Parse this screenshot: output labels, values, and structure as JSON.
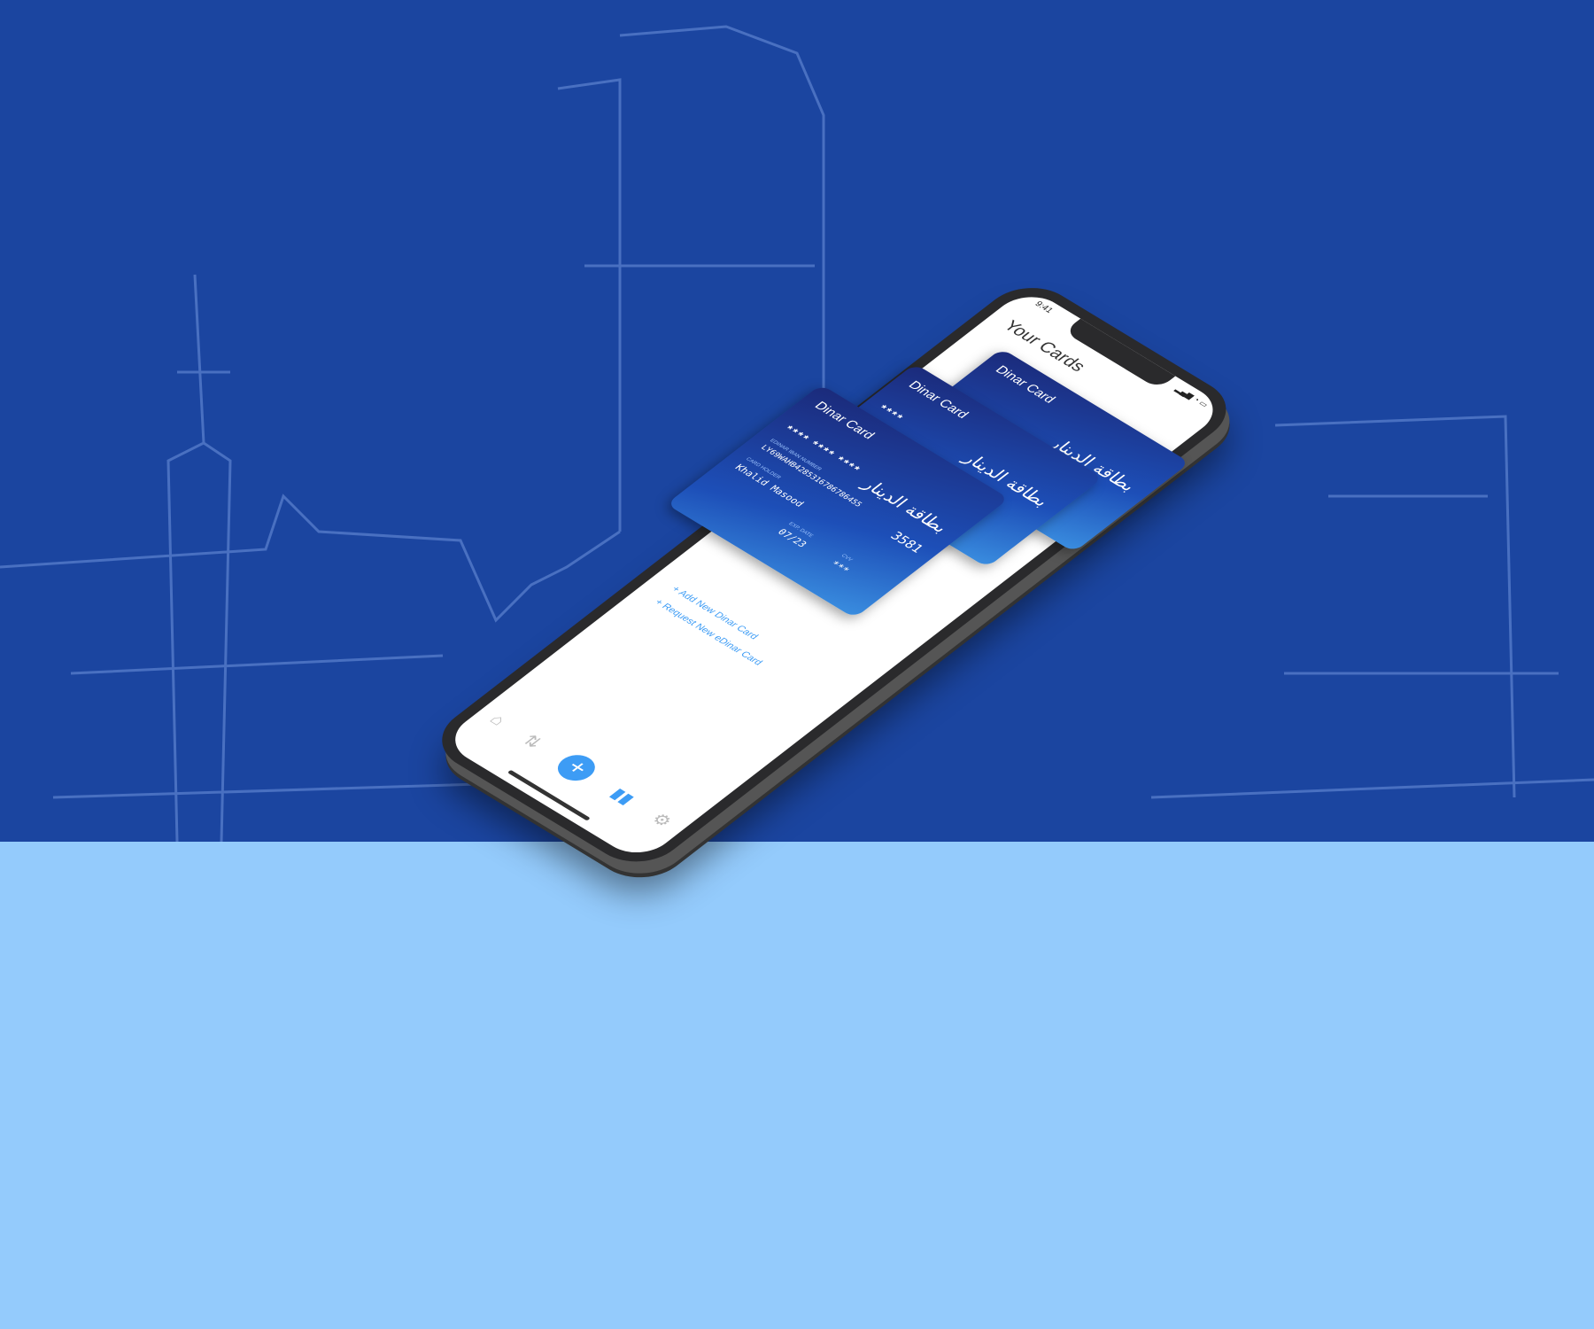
{
  "colors": {
    "background_top": "#1b45a0",
    "background_bottom": "#94cbfc",
    "accent": "#3d9cf5"
  },
  "phone": {
    "status_time": "9:41",
    "title": "Your Cards",
    "cards": [
      {
        "name": "Dinar Card",
        "logo": "بطاقة الدينار"
      },
      {
        "name": "Dinar Card",
        "logo": "بطاقة الدينار",
        "masked": "****"
      },
      {
        "name": "Dinar Card",
        "logo": "بطاقة الدينار",
        "number_masked": "****   ****   ****",
        "last4": "3581",
        "iban_label": "EDINAR IBAN NUMBER",
        "iban": "LY69WAHB4285316786786455",
        "holder_label": "CARD HOLDER",
        "holder": "Khalid Masood",
        "exp_label": "EXP. DATE",
        "exp": "07/23",
        "cvv_label": "CVV",
        "cvv": "***"
      }
    ],
    "links": {
      "add": "+ Add New Dinar Card",
      "request": "+ Request New eDinar Card"
    },
    "tabs": [
      {
        "icon": "home-icon"
      },
      {
        "icon": "transfer-icon"
      },
      {
        "icon": "plus-icon"
      },
      {
        "icon": "card-icon"
      },
      {
        "icon": "gear-icon"
      }
    ]
  }
}
